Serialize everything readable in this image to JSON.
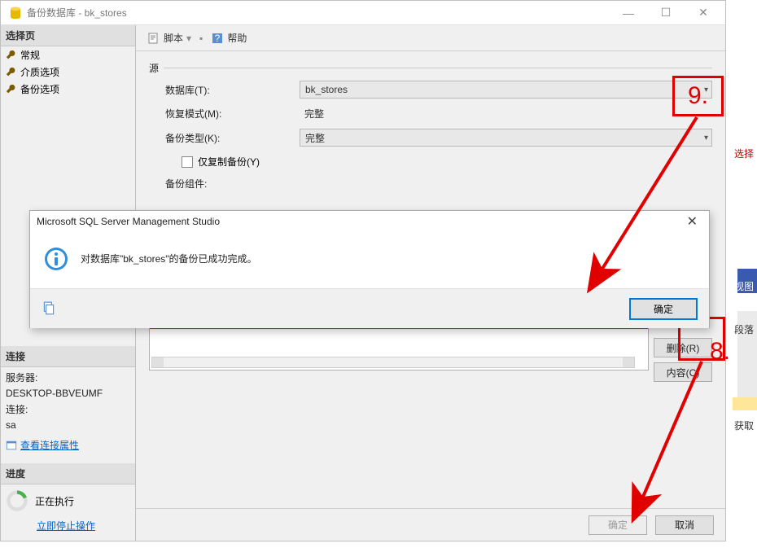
{
  "window": {
    "title": "备份数据库 - bk_stores"
  },
  "sidebar": {
    "select_page_header": "选择页",
    "items": [
      {
        "label": "常规"
      },
      {
        "label": "介质选项"
      },
      {
        "label": "备份选项"
      }
    ],
    "connection_header": "连接",
    "server_label": "服务器:",
    "server_value": "DESKTOP-BBVEUMF",
    "conn_label": "连接:",
    "conn_value": "sa",
    "view_conn_props": "查看连接属性",
    "progress_header": "进度",
    "progress_status": "正在执行",
    "stop_link": "立即停止操作"
  },
  "toolbar": {
    "script": "脚本",
    "help": "帮助"
  },
  "form": {
    "source_group": "源",
    "database_label": "数据库(T):",
    "database_value": "bk_stores",
    "recovery_label": "恢复模式(M):",
    "recovery_value": "完整",
    "backup_type_label": "备份类型(K):",
    "backup_type_value": "完整",
    "copy_only": "仅复制备份(Y)",
    "component_label": "备份组件:"
  },
  "dest_buttons": {
    "remove": "删除(R)",
    "content": "内容(C)"
  },
  "bottom": {
    "ok": "确定",
    "cancel": "取消"
  },
  "msgbox": {
    "title": "Microsoft SQL Server Management Studio",
    "message": "对数据库\"bk_stores\"的备份已成功完成。",
    "ok": "确定"
  },
  "annotations": {
    "n9": "9.",
    "n8": "8."
  },
  "right_clip": {
    "sel": "选择",
    "view": "视图",
    "para": "段落",
    "get": "获取"
  }
}
